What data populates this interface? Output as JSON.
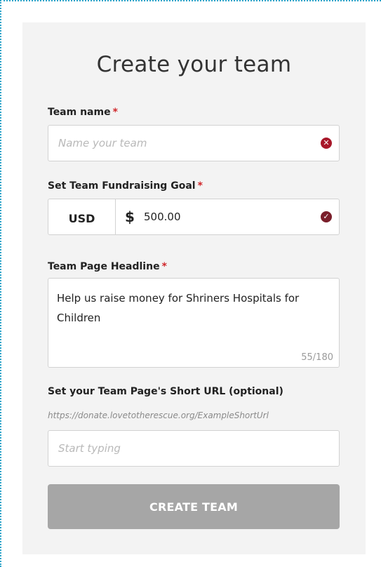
{
  "form": {
    "title": "Create your team",
    "team_name": {
      "label": "Team name",
      "required": "*",
      "placeholder": "Name your team",
      "status_icon": "error-circle-icon"
    },
    "goal": {
      "label": "Set Team Fundraising Goal",
      "required": "*",
      "currency": "USD",
      "symbol": "$",
      "value": "500.00",
      "status_icon": "check-circle-icon"
    },
    "headline": {
      "label": "Team Page Headline",
      "required": "*",
      "value": "Help us raise money for Shriners Hospitals for Children",
      "counter": "55/180"
    },
    "short_url": {
      "label": "Set your Team Page's Short URL (optional)",
      "hint": "https://donate.lovetotherescue.org/ExampleShortUrl",
      "placeholder": "Start typing"
    },
    "submit_label": "CREATE TEAM"
  },
  "colors": {
    "required": "#d0262a",
    "error_icon": "#a8182a",
    "ok_icon": "#7a1f2b",
    "button": "#a6a6a6",
    "card": "#f3f3f3",
    "frame_dots": "#2aa3c9"
  }
}
